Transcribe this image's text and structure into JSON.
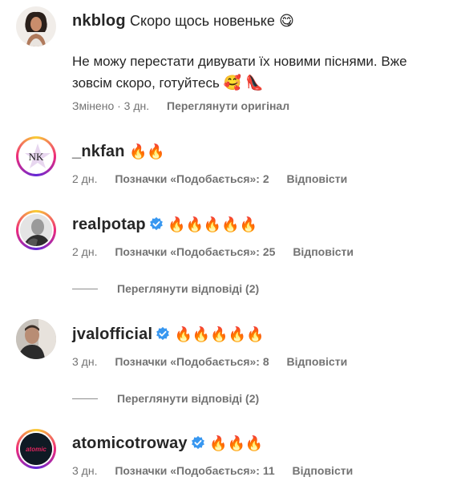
{
  "post": {
    "username": "nkblog",
    "caption": "Скоро щось новеньке",
    "caption_emoji": "😋",
    "body": "Не можу перестати дивувати їх новими піснями. Вже зовсім скоро, готуйтесь",
    "body_emoji": "🥰 👠",
    "meta_time": "Змінено · 3 дн.",
    "meta_action": "Переглянути оригінал"
  },
  "comments": [
    {
      "username": "_nkfan",
      "emoji": "🔥🔥",
      "time": "2 дн.",
      "likes": "Позначки «Подобається»: 2",
      "reply": "Відповісти",
      "avatar_text": "NK"
    },
    {
      "username": "realpotap",
      "emoji": "🔥🔥🔥🔥🔥",
      "time": "2 дн.",
      "likes": "Позначки «Подобається»: 25",
      "reply": "Відповісти",
      "view_replies": "Переглянути відповіді (2)"
    },
    {
      "username": "jvalofficial",
      "emoji": "🔥🔥🔥🔥🔥",
      "time": "3 дн.",
      "likes": "Позначки «Подобається»: 8",
      "reply": "Відповісти",
      "view_replies": "Переглянути відповіді (2)"
    },
    {
      "username": "atomicotroway",
      "emoji": "🔥🔥🔥",
      "time": "3 дн.",
      "likes": "Позначки «Подобається»: 11",
      "reply": "Відповісти",
      "avatar_text": "atomic"
    }
  ],
  "colors": {
    "verified": "#3897f0",
    "secondary_text": "#737373"
  }
}
